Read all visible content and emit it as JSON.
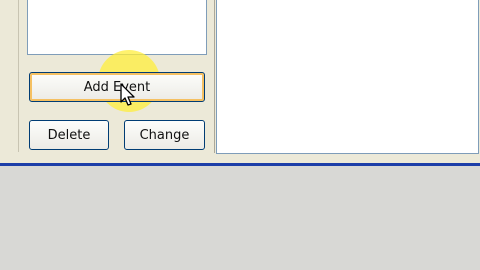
{
  "buttons": {
    "add_event": "Add Event",
    "delete": "Delete",
    "change": "Change"
  },
  "icons": {
    "cursor": "arrow-cursor-icon"
  },
  "colors": {
    "window_bg": "#ece9d8",
    "border_blue": "#1c3ea8",
    "highlight": "#ffee3c",
    "button_border": "#003c74"
  }
}
